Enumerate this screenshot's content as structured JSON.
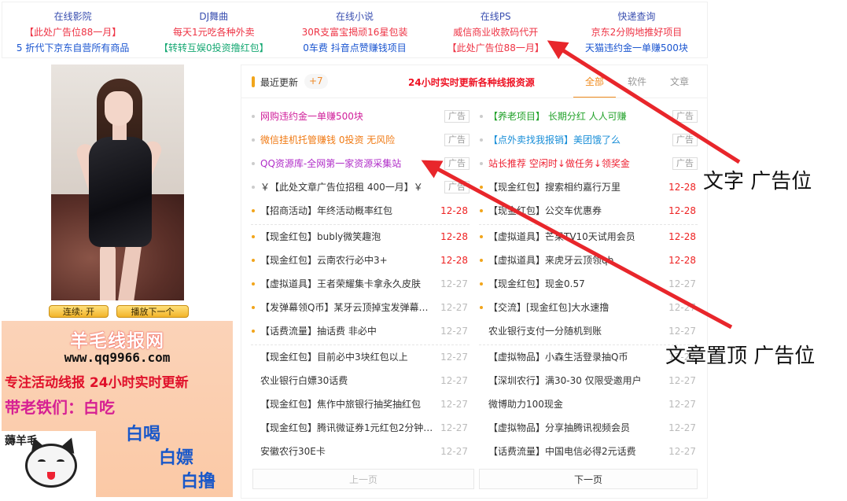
{
  "topnav": [
    {
      "head": "在线影院",
      "l2": "【此处广告位88一月】",
      "l3": "5 折代下京东自营所有商品",
      "l3class": "l3"
    },
    {
      "head": "DJ舞曲",
      "l2": "每天1元吃各种外卖",
      "l3": "【转转互娱0投资撸红包】",
      "l3class": "l3 green"
    },
    {
      "head": "在线小说",
      "l2": "30R支富宝揭顽16星包装",
      "l3": "0车费 抖音点赞赚钱项目",
      "l3class": "l3"
    },
    {
      "head": "在线PS",
      "l2": "威信商业收款码代开",
      "l3": "【此处广告位88一月】",
      "l3class": "l3 red"
    },
    {
      "head": "快递查询",
      "l2": "京东2分购地推好项目",
      "l3": "天猫违约金一单赚500块",
      "l3class": "l3"
    }
  ],
  "sidebar": {
    "play_toggle": "连续: 开",
    "play_next": "播放下一个",
    "banner": {
      "title": "羊毛线报网",
      "url": "www.qq9966.com",
      "tagline": "专注活动线报 24小时实时更新",
      "line1": "带老铁们：白吃",
      "line2": "白喝",
      "line3": "白嫖",
      "line4": "白撸",
      "cat_caption": "薅羊毛"
    }
  },
  "main": {
    "title": "最近更新",
    "badge": "+7",
    "slogan": "24小时实时更新各种线报资源",
    "tabs": [
      "全部",
      "软件",
      "文章"
    ],
    "prev": "上一页",
    "next": "下一页"
  },
  "left_items": [
    {
      "text": "网购违约金一单赚500块",
      "color": "#d01f9a",
      "ad": "广告",
      "dot": "#ccc"
    },
    {
      "text": "微信挂机托管赚钱 0投资 无风险",
      "color": "#f07a14",
      "ad": "广告",
      "dot": "#ccc"
    },
    {
      "text": "QQ资源库-全网第一家资源采集站",
      "color": "#b02dc8",
      "ad": "广告",
      "dot": "#ccc"
    },
    {
      "text": "￥【此处文章广告位招租 400一月】￥",
      "color": "#333",
      "ad": "广告",
      "dot": "#ccc"
    },
    {
      "text": "【招商活动】年终活动概率红包",
      "date": "12-28",
      "new": true,
      "dot": "#f1a51b",
      "sep": true
    },
    {
      "text": "【现金红包】bubly微笑趣泡",
      "date": "12-28",
      "new": true,
      "dot": "#f1a51b"
    },
    {
      "text": "【现金红包】云南农行必中3+",
      "date": "12-28",
      "new": true,
      "dot": "#f1a51b"
    },
    {
      "text": "【虚拟道具】王者荣耀集卡拿永久皮肤",
      "date": "12-27",
      "new": false,
      "dot": "#f1a51b"
    },
    {
      "text": "【发弹幕领Q币】某牙云顶掉宝发弹幕领…",
      "date": "12-27",
      "new": false,
      "dot": "#f1a51b"
    },
    {
      "text": "【话费流量】抽话费 非必中",
      "date": "12-27",
      "new": false,
      "dot": "#f1a51b",
      "sep": true
    },
    {
      "text": "【现金红包】目前必中3块红包以上",
      "date": "12-27",
      "new": false
    },
    {
      "text": "农业银行白嫖30话费",
      "date": "12-27",
      "new": false
    },
    {
      "text": "【现金红包】焦作中旅银行抽奖抽红包",
      "date": "12-27",
      "new": false
    },
    {
      "text": "【现金红包】腾讯微证券1元红包2分钟速…",
      "date": "12-27",
      "new": false
    },
    {
      "text": "安徽农行30E卡",
      "date": "12-27",
      "new": false
    }
  ],
  "right_items": [
    {
      "text": "【养老项目】 长期分红 人人可赚",
      "color": "#22a22a",
      "ad": "广告",
      "dot": "#ccc"
    },
    {
      "text": "【点外卖找我报销】美团饿了么",
      "color": "#1a8fd8",
      "ad": "广告",
      "dot": "#ccc"
    },
    {
      "text": "站长推荐 空闲时↓做任务↓领奖金",
      "color": "#ee2233",
      "ad": "广告",
      "dot": "#ccc"
    },
    {
      "text": "【现金红包】搜索相约嘉行万里",
      "date": "12-28",
      "new": true,
      "dot": "#f1a51b"
    },
    {
      "text": "【现金红包】公交车优惠券",
      "date": "12-28",
      "new": true,
      "dot": "#f1a51b",
      "sep": true
    },
    {
      "text": "【虚拟道具】芒果TV10天试用会员",
      "date": "12-28",
      "new": true,
      "dot": "#f1a51b"
    },
    {
      "text": "【虚拟道具】来虎牙云顶领qb",
      "date": "12-28",
      "new": true,
      "dot": "#f1a51b"
    },
    {
      "text": "【现金红包】现金0.57",
      "date": "12-27",
      "new": false,
      "dot": "#f1a51b"
    },
    {
      "text": "【交流】[现金红包]大水速撸",
      "date": "12-27",
      "new": false,
      "dot": "#f1a51b"
    },
    {
      "text": "农业银行支付一分随机到账",
      "date": "12-27",
      "new": false,
      "sep": true
    },
    {
      "text": "【虚拟物品】小森生活登录抽Q币",
      "date": "12-27",
      "new": false
    },
    {
      "text": "【深圳农行】满30-30 仅限受邀用户",
      "date": "12-27",
      "new": false
    },
    {
      "text": "微博助力100现金",
      "date": "12-27",
      "new": false
    },
    {
      "text": "【虚拟物品】分享抽腾讯视频会员",
      "date": "12-27",
      "new": false
    },
    {
      "text": "【话费流量】中国电信必得2元话费",
      "date": "12-27",
      "new": false
    }
  ],
  "annotations": {
    "label1": "文字 广告位",
    "label2": "文章置顶 广告位",
    "arrow_color": "#e8262b"
  }
}
